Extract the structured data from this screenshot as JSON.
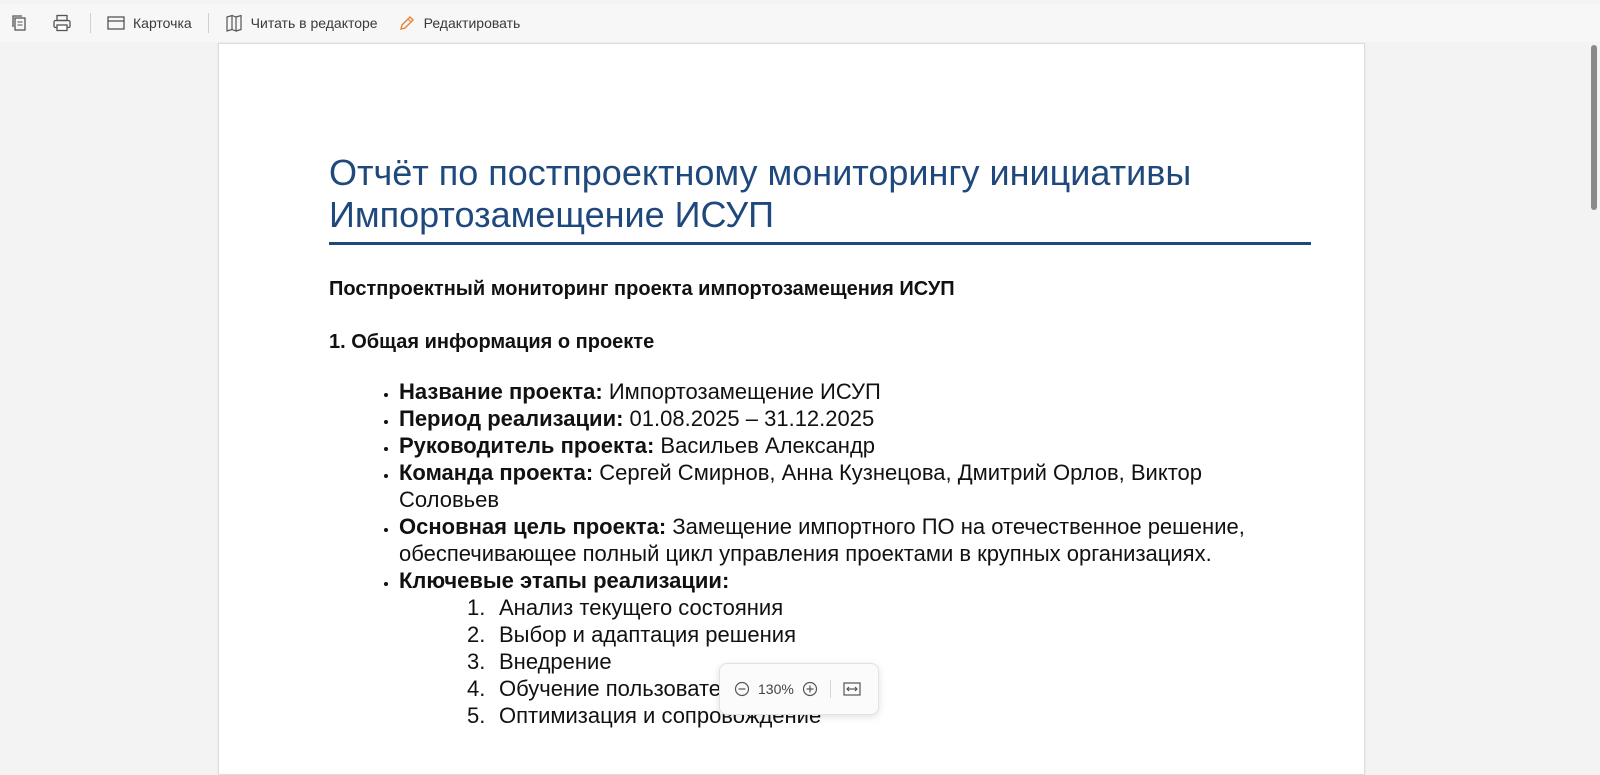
{
  "toolbar": {
    "card_label": "Карточка",
    "read_in_editor_label": "Читать в редакторе",
    "edit_label": "Редактировать"
  },
  "document": {
    "title": "Отчёт по постпроектному мониторингу инициативы Импортозамещение ИСУП",
    "subtitle": "Постпроектный мониторинг проекта импортозамещения ИСУП",
    "section_heading": "1. Общая информация о проекте",
    "items": [
      {
        "label": "Название проекта:",
        "value": " Импортозамещение ИСУП"
      },
      {
        "label": "Период реализации:",
        "value": " 01.08.2025 – 31.12.2025"
      },
      {
        "label": "Руководитель проекта:",
        "value": " Васильев Александр"
      },
      {
        "label": "Команда проекта:",
        "value": " Сергей Смирнов, Анна Кузнецова, Дмитрий Орлов, Виктор Соловьев"
      },
      {
        "label": "Основная цель проекта:",
        "value": " Замещение импортного ПО на отечественное решение, обеспечивающее полный цикл управления проектами в крупных организациях."
      },
      {
        "label": "Ключевые этапы реализации:",
        "value": ""
      }
    ],
    "stages": [
      {
        "num": "1.",
        "text": "Анализ текущего состояния"
      },
      {
        "num": "2.",
        "text": "Выбор и адаптация решения"
      },
      {
        "num": "3.",
        "text": "Внедрение"
      },
      {
        "num": "4.",
        "text": "Обучение пользователей"
      },
      {
        "num": "5.",
        "text": "Оптимизация и сопровождение"
      }
    ]
  },
  "zoom": {
    "level": "130%"
  },
  "colors": {
    "title": "#1f497d",
    "edit_icon": "#e8823a"
  },
  "icons": {
    "copy": "copy-icon",
    "print": "print-icon",
    "card": "card-icon",
    "book": "book-icon",
    "pencil": "pencil-icon",
    "zoom_out": "zoom-out-icon",
    "zoom_in": "zoom-in-icon",
    "fit_width": "fit-width-icon"
  }
}
